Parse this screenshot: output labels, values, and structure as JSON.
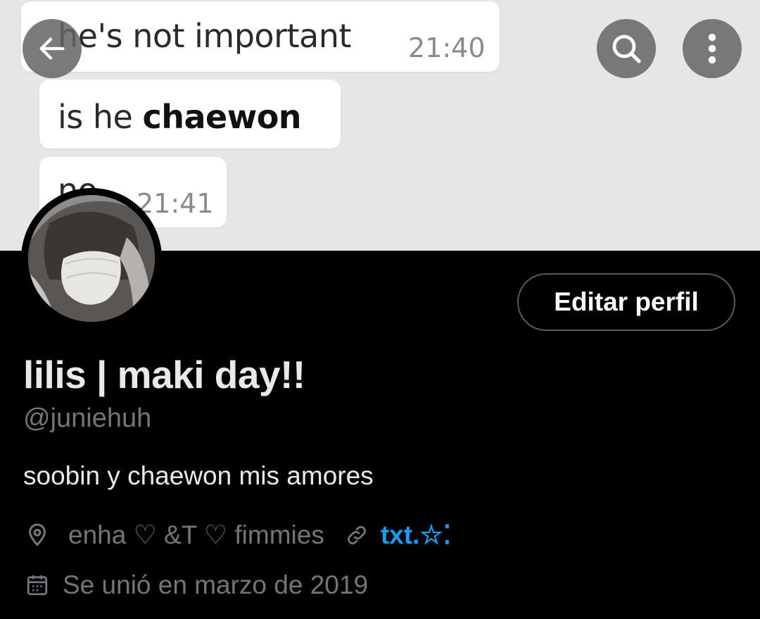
{
  "banner": {
    "messages": [
      {
        "text": "he's not important",
        "time": "21:40"
      },
      {
        "text_prefix": "is he ",
        "text_bold": "chaewon",
        "time": ""
      },
      {
        "text": "no",
        "time": "21:41"
      }
    ]
  },
  "nav": {
    "back_icon": "arrow-left-icon",
    "search_icon": "search-icon",
    "more_icon": "more-vertical-icon"
  },
  "profile": {
    "edit_label": "Editar perfil",
    "display_name": "lilis | maki day!!",
    "handle": "@juniehuh",
    "bio": "soobin y chaewon mis amores",
    "location": "enha ♡ &T ♡ fimmies",
    "website": "txt.☆⁚",
    "joined": "Se unió en marzo de 2019"
  },
  "colors": {
    "background": "#000000",
    "primary_text": "#e7e9ea",
    "secondary_text": "#71767b",
    "link": "#1d9bf0",
    "button_border": "#545b61"
  }
}
